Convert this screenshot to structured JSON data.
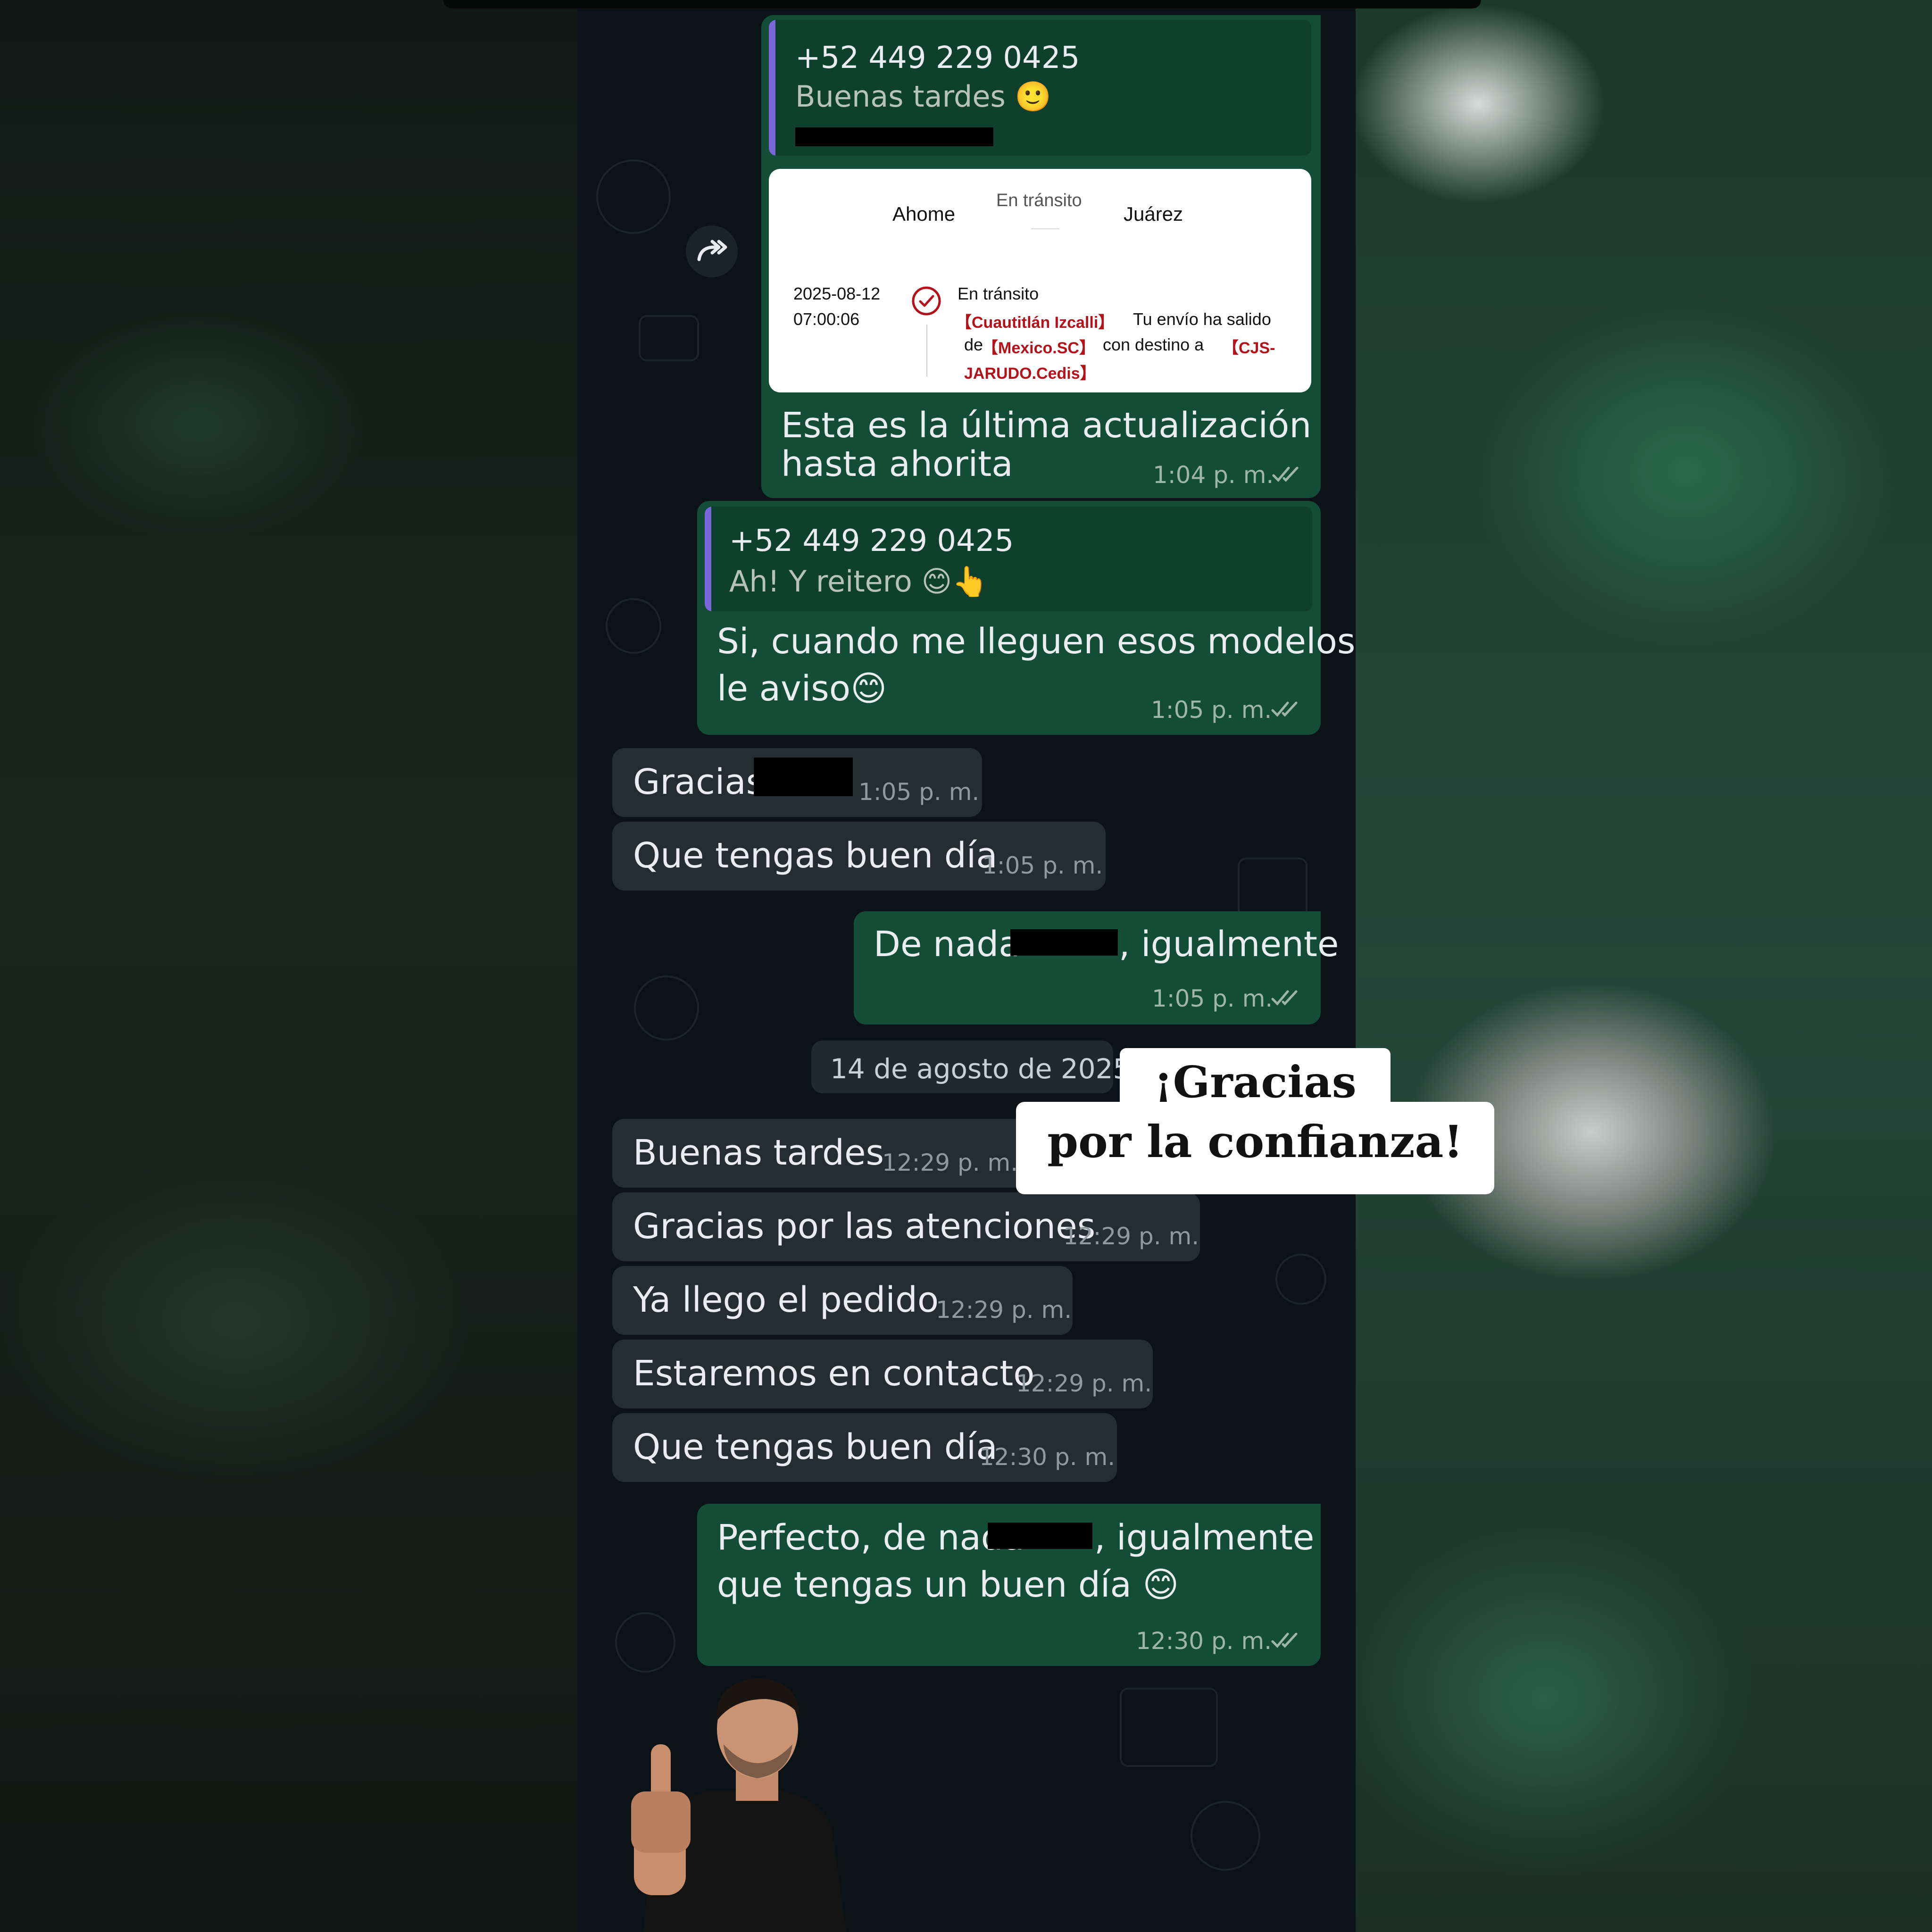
{
  "messages": {
    "m1": {
      "quote_name": "+52 449 229 0425",
      "quote_text": "Buenas tardes 🙂",
      "card": {
        "from": "Ahome",
        "status_top": "En tránsito",
        "to": "Juárez",
        "date": "2025-08-12",
        "time": "07:00:06",
        "event_title": "En tránsito",
        "loc1": "【Cuautitlán Izcalli】",
        "text1": "Tu envío ha salido",
        "de": "de",
        "loc2": "【Mexico.SC】",
        "text2": "con destino a",
        "loc3a": "【CJS-",
        "loc3b": "JARUDO.Cedis】"
      },
      "line1": "Esta es la última actualización",
      "line2": "hasta ahorita",
      "time": "1:04 p. m."
    },
    "m2": {
      "quote_name": "+52 449 229 0425",
      "quote_text": "Ah! Y reitero 😊👆",
      "line1": "Si, cuando me lleguen esos modelos",
      "line2": "le aviso😊",
      "time": "1:05 p. m."
    },
    "m3": {
      "text": "Gracias",
      "time": "1:05 p. m."
    },
    "m4": {
      "text": "Que tengas buen día",
      "time": "1:05 p. m."
    },
    "m5": {
      "text_a": "De nada",
      "text_b": ", igualmente",
      "time": "1:05 p. m."
    },
    "date_separator": "14 de agosto de 2025",
    "m6": {
      "text": "Buenas tardes",
      "time": "12:29 p. m."
    },
    "m7": {
      "text": "Gracias por las atenciones",
      "time": "12:29 p. m."
    },
    "m8": {
      "text": "Ya llego el pedido",
      "time": "12:29 p. m."
    },
    "m9": {
      "text": "Estaremos en contacto",
      "time": "12:29 p. m."
    },
    "m10": {
      "text": "Que tengas buen día",
      "time": "12:30 p. m."
    },
    "m11": {
      "line1a": "Perfecto, de nada",
      "line1b": ", igualmente",
      "line2": "que tengas un buen día 😊",
      "time": "12:30 p. m."
    }
  },
  "overlay": {
    "line1": "¡Gracias",
    "line2": "por la confianza!"
  },
  "icons": {
    "forward": "forward-icon",
    "read_receipt": "double-check-icon",
    "event_check": "check-circle-icon"
  },
  "colors": {
    "outgoing_bubble": "#134d37",
    "incoming_bubble": "#242d31",
    "chat_background": "#0c1316",
    "quote_bar": "#7a67d8",
    "tracking_red": "#b3121b"
  }
}
